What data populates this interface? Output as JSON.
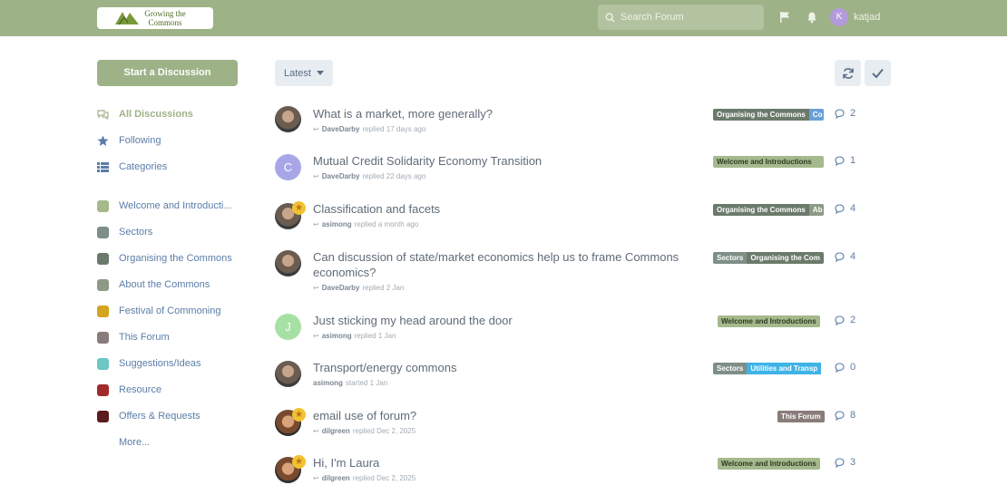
{
  "header": {
    "logo_text": "Growing the Commons",
    "search_placeholder": "Search Forum",
    "avatar_letter": "K",
    "username": "katjad"
  },
  "sidebar": {
    "start_button": "Start a Discussion",
    "nav": [
      {
        "label": "All Discussions",
        "icon": "comments-icon"
      },
      {
        "label": "Following",
        "icon": "star-icon"
      },
      {
        "label": "Categories",
        "icon": "list-icon"
      }
    ],
    "tags": [
      {
        "label": "Welcome and Introducti...",
        "color": "#a5b98c"
      },
      {
        "label": "Sectors",
        "color": "#7d8f86"
      },
      {
        "label": "Organising the Commons",
        "color": "#6b7a6a"
      },
      {
        "label": "About the Commons",
        "color": "#8c9a86"
      },
      {
        "label": "Festival of Commoning",
        "color": "#d4a41e"
      },
      {
        "label": "This Forum",
        "color": "#8a7c7a"
      },
      {
        "label": "Suggestions/Ideas",
        "color": "#6cc7c6"
      },
      {
        "label": "Resource",
        "color": "#a12a2a"
      },
      {
        "label": "Offers & Requests",
        "color": "#5a1c1c"
      }
    ],
    "more": "More..."
  },
  "toolbar": {
    "sort_label": "Latest"
  },
  "discussions": [
    {
      "title": "What is a market, more generally?",
      "user": "DaveDarby",
      "action": "replied 17 days ago",
      "tags": [
        "Organising the Commons",
        "Co"
      ],
      "replies": "2"
    },
    {
      "title": "Mutual Credit Solidarity Economy Transition",
      "user": "DaveDarby",
      "action": "replied 22 days ago",
      "tags": [
        "Welcome and Introductions"
      ],
      "replies": "1",
      "avatar_letter": "C"
    },
    {
      "title": "Classification and facets",
      "user": "asimong",
      "action": "replied a month ago",
      "tags": [
        "Organising the Commons",
        "Ab"
      ],
      "replies": "4"
    },
    {
      "title": "Can discussion of state/market economics help us to frame Commons economics?",
      "user": "DaveDarby",
      "action": "replied 2 Jan",
      "tags": [
        "Sectors",
        "Organising the Com"
      ],
      "replies": "4"
    },
    {
      "title": "Just sticking my head around the door",
      "user": "asimong",
      "action": "replied 1 Jan",
      "tags": [
        "Welcome and Introductions"
      ],
      "replies": "2",
      "avatar_letter": "J"
    },
    {
      "title": "Transport/energy commons",
      "user": "asimong",
      "action": "started 1 Jan",
      "tags": [
        "Sectors",
        "Utilities and Transp"
      ],
      "replies": "0"
    },
    {
      "title": "email use of forum?",
      "user": "dilgreen",
      "action": "replied Dec 2, 2025",
      "tags": [
        "This Forum"
      ],
      "replies": "8"
    },
    {
      "title": "Hi, I'm Laura",
      "user": "dilgreen",
      "action": "replied Dec 2, 2025",
      "tags": [
        "Welcome and Introductions"
      ],
      "replies": "3"
    }
  ]
}
